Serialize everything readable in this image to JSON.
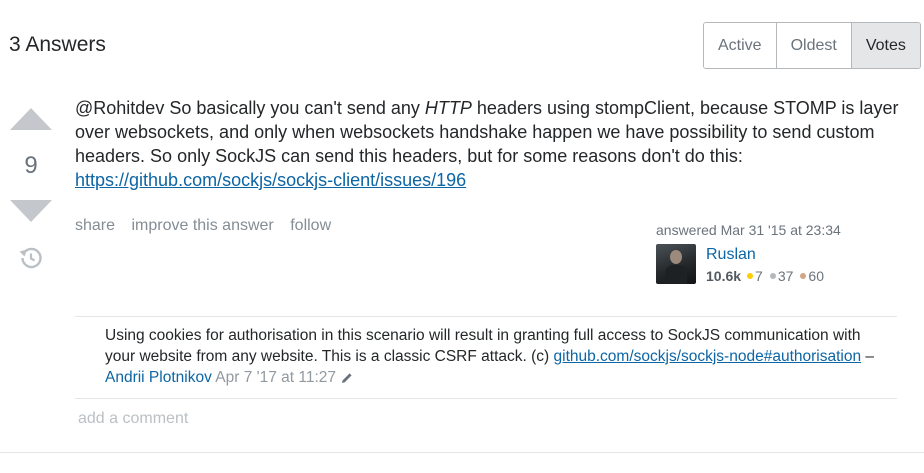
{
  "header": {
    "answers_count": "3 Answers",
    "sort_tabs": [
      "Active",
      "Oldest",
      "Votes"
    ],
    "active_tab": "Votes"
  },
  "vote": {
    "count": "9",
    "up_icon": "arrow-up-icon",
    "down_icon": "arrow-down-icon",
    "history_icon": "history-icon"
  },
  "answer": {
    "text_part1": "@Rohitdev So basically you can't send any ",
    "text_em": "HTTP",
    "text_part2": " headers using stompClient, because STOMP is layer over websockets, and only when websockets handshake happen we have possibility to send custom headers. So only SockJS can send this headers, but for some reasons don't do this: ",
    "link": "https://github.com/sockjs/sockjs-client/issues/196"
  },
  "post_menu": {
    "share": "share",
    "improve": "improve this answer",
    "follow": "follow"
  },
  "user": {
    "action_time": "answered Mar 31 '15 at 23:34",
    "name": "Ruslan",
    "reputation": "10.6k",
    "gold_badges": "7",
    "silver_badges": "37",
    "bronze_badges": "60",
    "gold_color": "#ffcc01",
    "silver_color": "#b4b8bc",
    "bronze_color": "#d1a684"
  },
  "comment": {
    "text": "Using cookies for authorisation in this scenario will result in granting full access to SockJS communication with your website from any website. This is a classic CSRF attack. (c) ",
    "link": "github.com/sockjs/sockjs-node#authorisation",
    "separator": " – ",
    "user": "Andrii Plotnikov",
    "date": "Apr 7 '17 at 11:27",
    "edit_icon": "pencil-icon"
  },
  "add_comment": "add a comment",
  "colors": {
    "link": "#0c65a5",
    "muted": "#6a737c",
    "vote_arrow": "#c4c8cc"
  }
}
